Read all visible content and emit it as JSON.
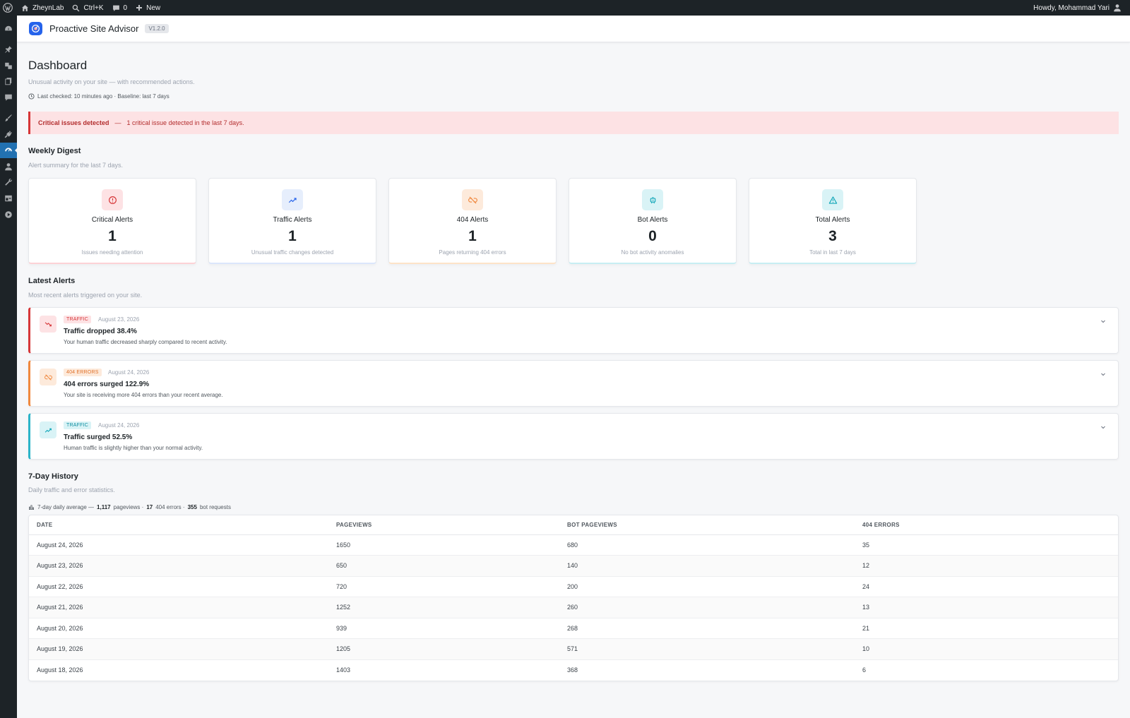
{
  "adminbar": {
    "site_name": "ZheynLab",
    "search_shortcut": "Ctrl+K",
    "comments_count": "0",
    "new_label": "New",
    "howdy": "Howdy, Mohammad Yari"
  },
  "plugin": {
    "title": "Proactive Site Advisor",
    "version": "V1.2.0"
  },
  "dashboard": {
    "title": "Dashboard",
    "subtitle": "Unusual activity on your site — with recommended actions.",
    "last_checked": "Last checked: 10 minutes ago · Baseline: last 7 days"
  },
  "banner": {
    "title": "Critical issues detected",
    "separator": "—",
    "message": "1 critical issue detected in the last 7 days."
  },
  "weekly_digest": {
    "title": "Weekly Digest",
    "subtitle": "Alert summary for the last 7 days.",
    "cards": [
      {
        "label": "Critical Alerts",
        "value": "1",
        "note": "Issues needing attention",
        "icon": "alert-circle-icon",
        "color": "#d63638"
      },
      {
        "label": "Traffic Alerts",
        "value": "1",
        "note": "Unusual traffic changes detected",
        "icon": "trend-up-icon",
        "color": "#2563eb"
      },
      {
        "label": "404 Alerts",
        "value": "1",
        "note": "Pages returning 404 errors",
        "icon": "broken-link-icon",
        "color": "#f0883e"
      },
      {
        "label": "Bot Alerts",
        "value": "0",
        "note": "No bot activity anomalies",
        "icon": "robot-icon",
        "color": "#0ea5b7"
      },
      {
        "label": "Total Alerts",
        "value": "3",
        "note": "Total in last 7 days",
        "icon": "warning-triangle-icon",
        "color": "#0ea5b7"
      }
    ]
  },
  "latest_alerts": {
    "title": "Latest Alerts",
    "subtitle": "Most recent alerts triggered on your site.",
    "items": [
      {
        "tag": "TRAFFIC",
        "date": "August 23, 2026",
        "title": "Traffic dropped 38.4%",
        "desc": "Your human traffic decreased sharply compared to recent activity.",
        "icon": "trend-down-icon"
      },
      {
        "tag": "404 ERRORS",
        "date": "August 24, 2026",
        "title": "404 errors surged 122.9%",
        "desc": "Your site is receiving more 404 errors than your recent average.",
        "icon": "broken-link-icon"
      },
      {
        "tag": "TRAFFIC",
        "date": "August 24, 2026",
        "title": "Traffic surged 52.5%",
        "desc": "Human traffic is slightly higher than your normal activity.",
        "icon": "trend-up-icon"
      }
    ]
  },
  "history": {
    "title": "7-Day History",
    "subtitle": "Daily traffic and error statistics.",
    "avg_prefix": "7-day daily average —",
    "avg_pageviews": "1,117",
    "avg_pageviews_label": "pageviews ·",
    "avg_404": "17",
    "avg_404_label": "404 errors ·",
    "avg_bot": "355",
    "avg_bot_label": "bot requests",
    "columns": [
      "DATE",
      "PAGEVIEWS",
      "BOT PAGEVIEWS",
      "404 ERRORS"
    ],
    "rows": [
      [
        "August 24, 2026",
        "1650",
        "680",
        "35"
      ],
      [
        "August 23, 2026",
        "650",
        "140",
        "12"
      ],
      [
        "August 22, 2026",
        "720",
        "200",
        "24"
      ],
      [
        "August 21, 2026",
        "1252",
        "260",
        "13"
      ],
      [
        "August 20, 2026",
        "939",
        "268",
        "21"
      ],
      [
        "August 19, 2026",
        "1205",
        "571",
        "10"
      ],
      [
        "August 18, 2026",
        "1403",
        "368",
        "6"
      ]
    ]
  }
}
